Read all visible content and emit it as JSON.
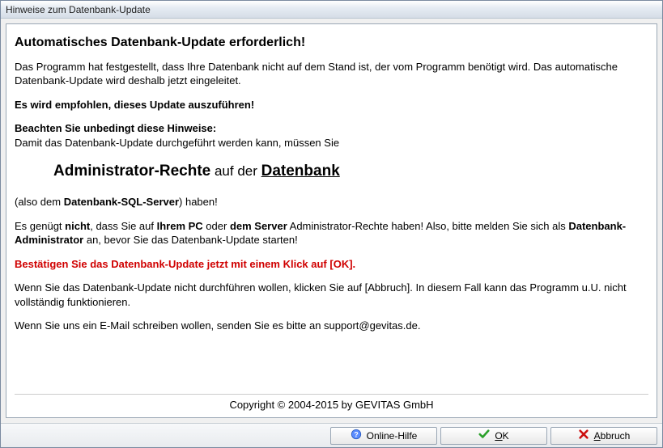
{
  "window": {
    "title": "Hinweise zum Datenbank-Update"
  },
  "content": {
    "heading": "Automatisches Datenbank-Update erforderlich!",
    "para1": "Das Programm hat festgestellt, dass Ihre Datenbank nicht auf dem Stand ist, der vom Programm benötigt wird. Das automatische Datenbank-Update wird deshalb jetzt eingeleitet.",
    "recommend": "Es wird empfohlen, dieses Update auszuführen!",
    "note_heading": "Beachten Sie unbedingt diese Hinweise:",
    "note_line": "Damit das Datenbank-Update durchgeführt werden kann, müssen Sie",
    "admin_rights": "Administrator-Rechte",
    "auf_der": " auf der ",
    "datenbank": "Datenbank",
    "also_dem_pre": "(also dem ",
    "sql_server": "Datenbank-SQL-Server",
    "also_dem_post": ") haben!",
    "line4_a": "Es genügt ",
    "line4_nicht": "nicht",
    "line4_b": ", dass Sie auf ",
    "line4_ihrempc": "Ihrem PC",
    "line4_c": " oder ",
    "line4_demserver": "dem Server",
    "line4_d": " Administrator-Rechte haben! Also, bitte melden Sie sich als ",
    "line4_dbadmin": "Datenbank-Administrator",
    "line4_e": " an, bevor Sie das Datenbank-Update starten!",
    "confirm_red": "Bestätigen Sie das Datenbank-Update jetzt mit einem Klick auf [OK].",
    "abort_info": "Wenn Sie das Datenbank-Update nicht durchführen wollen, klicken Sie auf [Abbruch]. In diesem Fall kann das Programm u.U. nicht vollständig funktionieren.",
    "email_info": "Wenn Sie uns ein E-Mail schreiben wollen, senden Sie es bitte an support@gevitas.de.",
    "copyright": "Copyright © 2004-2015 by GEVITAS GmbH"
  },
  "buttons": {
    "help_label": "Online-Hilfe",
    "ok_prefix_u": "O",
    "ok_rest": "K",
    "abort_prefix_u": "A",
    "abort_rest": "bbruch"
  }
}
